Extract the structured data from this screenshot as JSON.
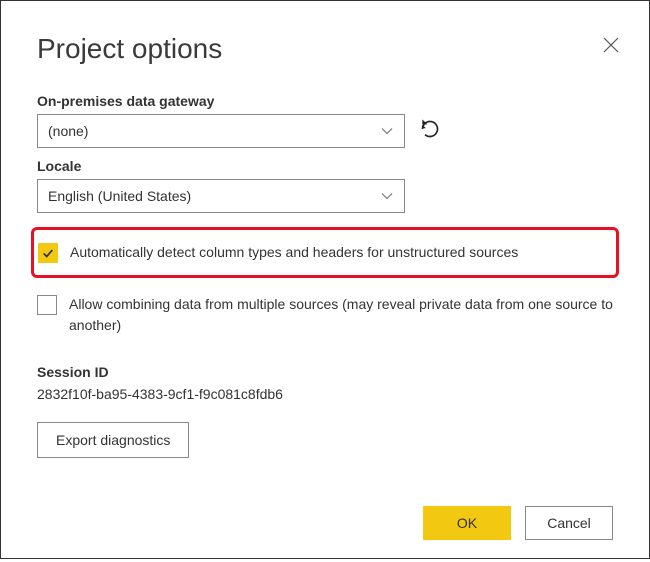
{
  "dialog": {
    "title": "Project options"
  },
  "gateway": {
    "label": "On-premises data gateway",
    "selected": "(none)"
  },
  "locale": {
    "label": "Locale",
    "selected": "English (United States)"
  },
  "options": {
    "autoDetect": "Automatically detect column types and headers for unstructured sources",
    "allowCombine": "Allow combining data from multiple sources (may reveal private data from one source to another)"
  },
  "session": {
    "label": "Session ID",
    "id": "2832f10f-ba95-4383-9cf1-f9c081c8fdb6"
  },
  "buttons": {
    "export": "Export diagnostics",
    "ok": "OK",
    "cancel": "Cancel"
  }
}
